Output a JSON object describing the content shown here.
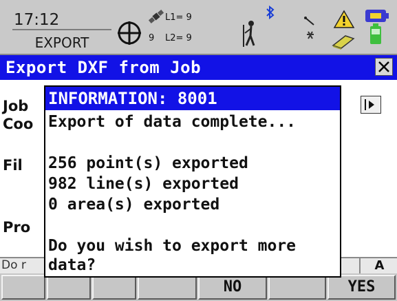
{
  "status": {
    "time": "17:12",
    "mode": "EXPORT",
    "sat_count": "9",
    "l1": "L1= 9",
    "l2": "L2= 9",
    "icons": [
      "satellite-crosshair-icon",
      "satellite-icon",
      "person-rover-icon",
      "bluetooth-icon",
      "radio-link-icon",
      "warning-icon",
      "memory-card-icon",
      "battery-icon"
    ]
  },
  "window": {
    "title": "Export DXF from Job",
    "close_icon": "close-x-icon"
  },
  "form": {
    "job_label": "Job",
    "coord_label": "Coo",
    "file_label": "Fil",
    "progress_label": "Pro",
    "hint_text": "Do r",
    "caps_indicator": "A"
  },
  "softkeys": [
    "",
    "",
    "",
    "",
    "NO",
    "",
    "YES"
  ],
  "dialog": {
    "title": "INFORMATION: 8001",
    "lines": [
      "Export of data complete...",
      "",
      "256 point(s) exported",
      "982 line(s) exported",
      "0 area(s) exported",
      "",
      "Do you wish to export more",
      "data?"
    ]
  },
  "colors": {
    "title_blue": "#1212e6",
    "statusbar_gray": "#c9c9c9",
    "warning_yellow": "#f2d22e",
    "battery_green": "#3fbf3f"
  }
}
